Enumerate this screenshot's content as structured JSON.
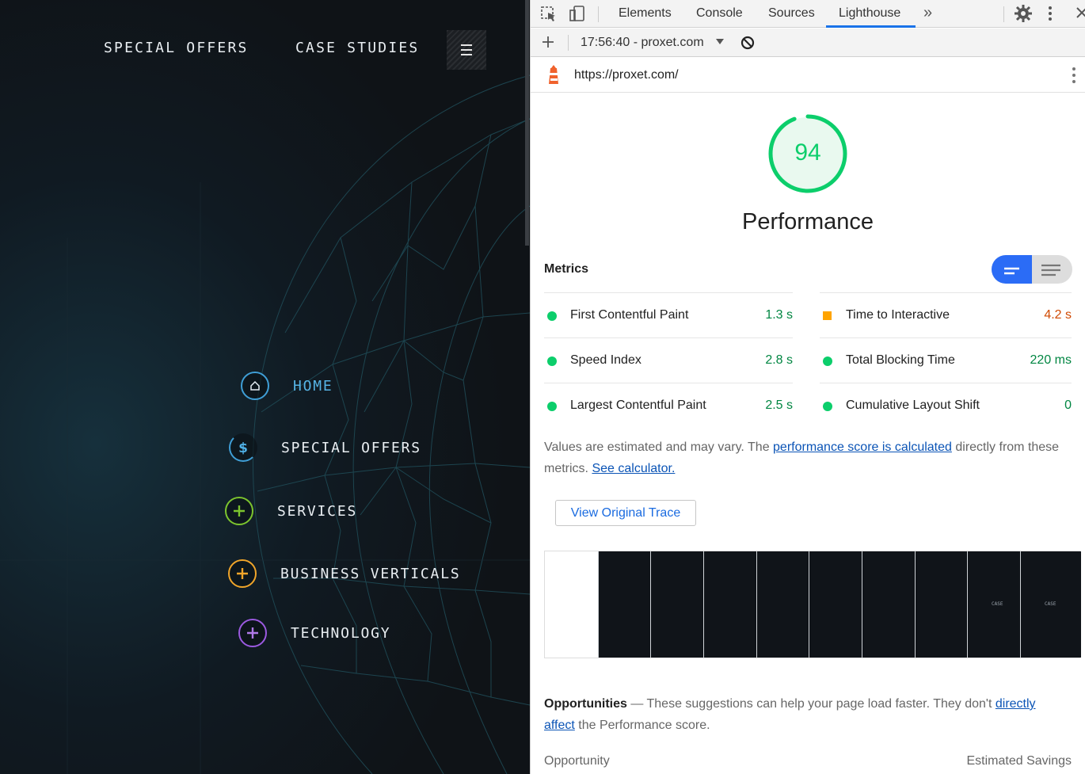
{
  "website": {
    "top_nav": [
      "SPECIAL OFFERS",
      "CASE STUDIES"
    ],
    "menu_items": [
      {
        "label": "HOME",
        "icon": "home-icon",
        "color": "#3f9ed6",
        "active": true
      },
      {
        "label": "SPECIAL OFFERS",
        "icon": "dollar-icon",
        "color": "#3f9ed6",
        "active": false
      },
      {
        "label": "SERVICES",
        "icon": "plus-icon",
        "color": "#7cc42e",
        "active": false
      },
      {
        "label": "BUSINESS VERTICALS",
        "icon": "plus-icon",
        "color": "#f0a52a",
        "active": false
      },
      {
        "label": "TECHNOLOGY",
        "icon": "plus-icon",
        "color": "#9b5ae0",
        "active": false
      }
    ]
  },
  "devtools": {
    "tabs": [
      "Elements",
      "Console",
      "Sources",
      "Lighthouse"
    ],
    "active_tab": "Lighthouse",
    "report_selector": "17:56:40 - proxet.com",
    "url": "https://proxet.com/",
    "score": "94",
    "score_value": 0.94,
    "category": "Performance",
    "metrics_title": "Metrics",
    "metrics": [
      {
        "name": "First Contentful Paint",
        "value": "1.3 s",
        "status": "pass"
      },
      {
        "name": "Time to Interactive",
        "value": "4.2 s",
        "status": "average"
      },
      {
        "name": "Speed Index",
        "value": "2.8 s",
        "status": "pass"
      },
      {
        "name": "Total Blocking Time",
        "value": "220 ms",
        "status": "pass"
      },
      {
        "name": "Largest Contentful Paint",
        "value": "2.5 s",
        "status": "pass"
      },
      {
        "name": "Cumulative Layout Shift",
        "value": "0",
        "status": "pass"
      }
    ],
    "estimate_note": {
      "text1": "Values are estimated and may vary. The ",
      "link1": "performance score is calculated",
      "text2": " directly from these metrics. ",
      "link2": "See calculator."
    },
    "trace_button": "View Original Trace",
    "filmstrip_caption": "CASE",
    "opportunities": {
      "title": "Opportunities",
      "text1": " — These suggestions can help your page load faster. They don't ",
      "link": "directly affect",
      "text2": " the Performance score.",
      "col_opportunity": "Opportunity",
      "col_savings": "Estimated Savings"
    },
    "colors": {
      "pass": "#0cce6b",
      "average": "#ffa400",
      "accent": "#1a73e8"
    }
  }
}
